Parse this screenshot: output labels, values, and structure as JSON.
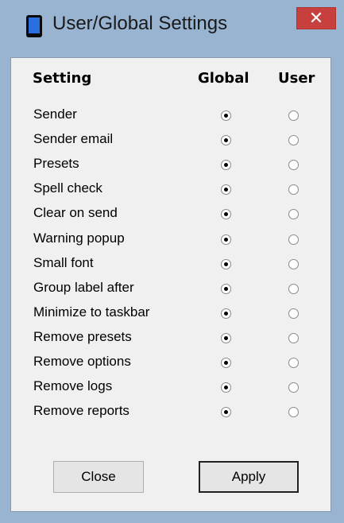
{
  "window": {
    "title": "User/Global Settings",
    "close_glyph": "✕"
  },
  "headers": {
    "setting": "Setting",
    "global": "Global",
    "user": "User"
  },
  "settings": [
    {
      "label": "Sender",
      "selected": "global"
    },
    {
      "label": "Sender email",
      "selected": "global"
    },
    {
      "label": "Presets",
      "selected": "global"
    },
    {
      "label": "Spell check",
      "selected": "global"
    },
    {
      "label": "Clear on send",
      "selected": "global"
    },
    {
      "label": "Warning popup",
      "selected": "global"
    },
    {
      "label": "Small font",
      "selected": "global"
    },
    {
      "label": "Group label after",
      "selected": "global"
    },
    {
      "label": "Minimize to taskbar",
      "selected": "global"
    },
    {
      "label": "Remove presets",
      "selected": "global"
    },
    {
      "label": "Remove options",
      "selected": "global"
    },
    {
      "label": "Remove logs",
      "selected": "global"
    },
    {
      "label": "Remove reports",
      "selected": "global"
    }
  ],
  "buttons": {
    "close": "Close",
    "apply": "Apply"
  },
  "colors": {
    "frame": "#99b4d1",
    "close_button": "#c7403d",
    "client_bg": "#f0f0f0"
  }
}
